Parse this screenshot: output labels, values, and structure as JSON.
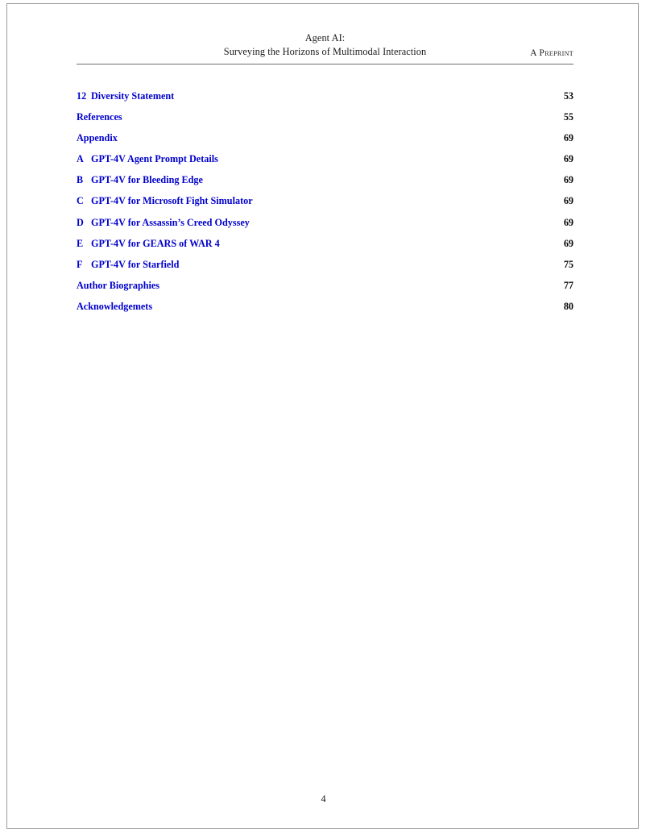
{
  "header": {
    "title_line1": "Agent AI:",
    "title_line2": "Surveying the Horizons of Multimodal Interaction",
    "preprint": "A Preprint"
  },
  "toc": {
    "entries": [
      {
        "label": "12",
        "title": "Diversity Statement",
        "page": "53"
      },
      {
        "label": "",
        "title": "References",
        "page": "55"
      },
      {
        "label": "",
        "title": "Appendix",
        "page": "69"
      },
      {
        "label": "A",
        "title": "GPT-4V Agent Prompt Details",
        "page": "69"
      },
      {
        "label": "B",
        "title": "GPT-4V for Bleeding Edge",
        "page": "69"
      },
      {
        "label": "C",
        "title": "GPT-4V for Microsoft Fight Simulator",
        "page": "69"
      },
      {
        "label": "D",
        "title": "GPT-4V for Assassin’s Creed Odyssey",
        "page": "69"
      },
      {
        "label": "E",
        "title": "GPT-4V for GEARS of WAR 4",
        "page": "69"
      },
      {
        "label": "F",
        "title": "GPT-4V for Starfield",
        "page": "75"
      },
      {
        "label": "",
        "title": "Author Biographies",
        "page": "77"
      },
      {
        "label": "",
        "title": "Acknowledgemets",
        "page": "80"
      }
    ]
  },
  "footer": {
    "page_number": "4"
  },
  "colors": {
    "link_blue": "#0000cd",
    "page_number_black": "#0d0d0d",
    "rule_gray": "#6e6e6e",
    "page_border": "#9a9a9a"
  }
}
